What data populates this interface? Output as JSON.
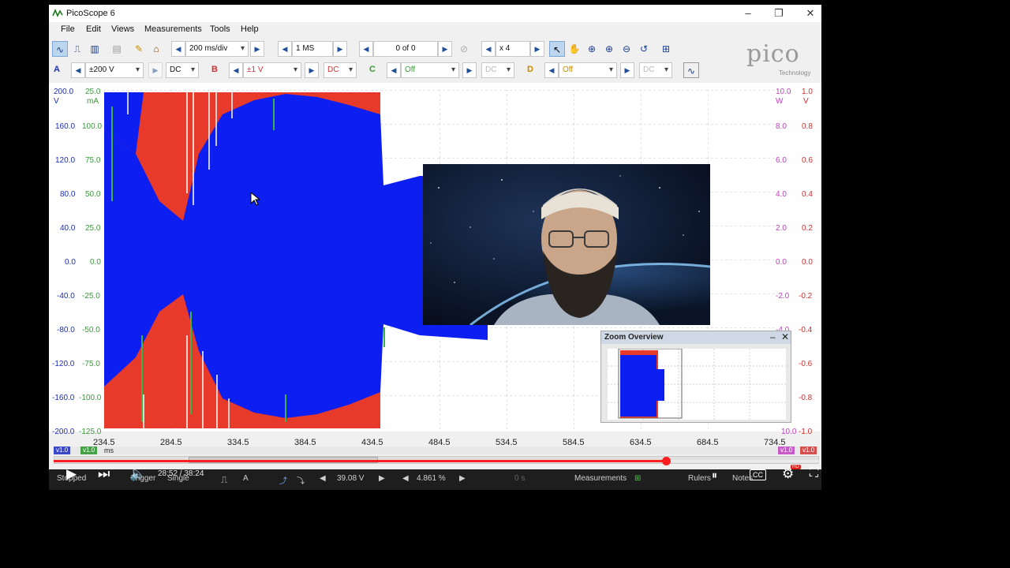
{
  "window": {
    "title": "PicoScope 6",
    "minimize": "–",
    "restore": "❐",
    "close": "✕"
  },
  "menu": [
    "File",
    "Edit",
    "Views",
    "Measurements",
    "Tools",
    "Help"
  ],
  "toolbar1": {
    "timebase": "200 ms/div",
    "samples": "1 MS",
    "buffer": "0 of 0",
    "zoom": "x 4"
  },
  "toolbar2": {
    "channel_a": {
      "label": "A",
      "range": "±200 V",
      "coupling": "DC"
    },
    "channel_b": {
      "label": "B",
      "range": "±1 V",
      "coupling": "DC"
    },
    "channel_c": {
      "label": "C",
      "range": "Off",
      "coupling": "DC"
    },
    "channel_d": {
      "label": "D",
      "range": "Off",
      "coupling": "DC"
    }
  },
  "logo": {
    "text": "pico",
    "sub": "Technology"
  },
  "plot": {
    "left_axis_v": {
      "unit": "V",
      "ticks": [
        "200.0",
        "160.0",
        "120.0",
        "80.0",
        "40.0",
        "0.0",
        "-40.0",
        "-80.0",
        "-120.0",
        "-160.0",
        "-200.0"
      ]
    },
    "left_axis_ma": {
      "unit": "mA",
      "ticks": [
        "25.0",
        "100.0",
        "75.0",
        "50.0",
        "25.0",
        "0.0",
        "-25.0",
        "-50.0",
        "-75.0",
        "-100.0",
        "-125.0"
      ]
    },
    "right_axis_w": {
      "unit": "W",
      "ticks": [
        "10.0",
        "8.0",
        "6.0",
        "4.0",
        "2.0",
        "0.0",
        "-2.0",
        "-4.0",
        "",
        "",
        "10.0"
      ]
    },
    "right_axis_v": {
      "unit": "V",
      "ticks": [
        "1.0",
        "0.8",
        "0.6",
        "0.4",
        "0.2",
        "0.0",
        "-0.2",
        "-0.4",
        "-0.6",
        "-0.8",
        "-1.0"
      ]
    },
    "x_ticks": [
      "234.5",
      "284.5",
      "334.5",
      "384.5",
      "434.5",
      "484.5",
      "534.5",
      "584.5",
      "634.5",
      "684.5",
      "734.5"
    ],
    "x_unit": "ms",
    "ruler_tags": [
      "v1.0",
      "v1.0",
      "v1.0",
      "v1.0"
    ]
  },
  "zoom_overview": {
    "title": "Zoom Overview",
    "min": "–",
    "close": "✕"
  },
  "statusbar": {
    "state": "Stopped",
    "trigger": "Trigger",
    "mode": "Single",
    "channel": "A",
    "level": "39.08 V",
    "pretrigger": "4.861 %",
    "delay": "0 s",
    "measurements": "Measurements",
    "rulers": "Rulers",
    "notes": "Notes"
  },
  "video": {
    "time": "28:52 / 38:24",
    "progress": 0.8,
    "cc": "CC",
    "hd": "HD"
  }
}
